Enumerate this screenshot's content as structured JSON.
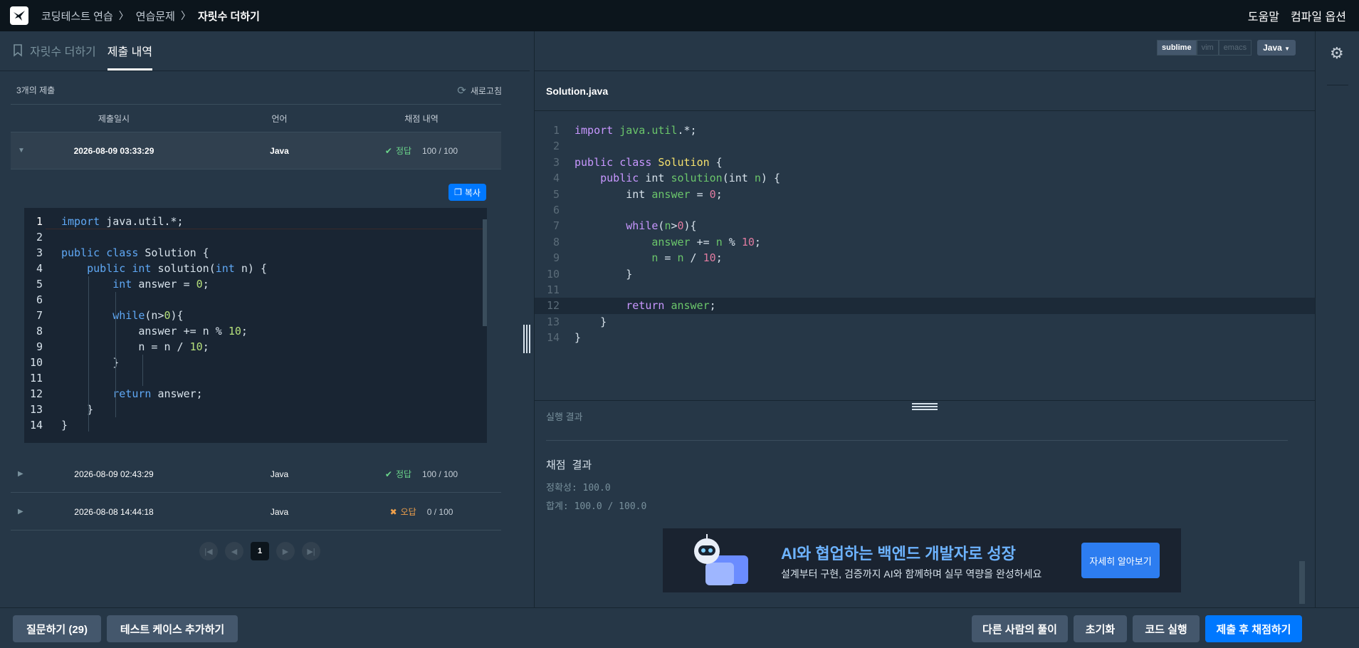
{
  "breadcrumb": {
    "items": [
      "코딩테스트 연습",
      "연습문제"
    ],
    "current": "자릿수 더하기"
  },
  "topnav": {
    "help": "도움말",
    "compile_options": "컴파일 옵션"
  },
  "tabs": [
    {
      "label": "자릿수 더하기"
    },
    {
      "label": "제출 내역"
    }
  ],
  "submissions": {
    "count_label": "3개의 제출",
    "refresh": "새로고침",
    "headers": [
      "제출일시",
      "언어",
      "채점 내역"
    ],
    "rows": [
      {
        "date": "2026-08-09 03:33:29",
        "lang": "Java",
        "result": "정답",
        "score": "100 / 100"
      },
      {
        "date": "2026-08-09 02:43:29",
        "lang": "Java",
        "result": "정답",
        "score": "100 / 100"
      },
      {
        "date": "2026-08-08 14:44:18",
        "lang": "Java",
        "result": "오답",
        "score": "0 / 100"
      }
    ],
    "copy": "복사"
  },
  "pager": {
    "page": "1"
  },
  "editor": {
    "keymaps": [
      "sublime",
      "vim",
      "emacs"
    ],
    "language": "Java",
    "filename": "Solution.java"
  },
  "run": {
    "header": "실행 결과",
    "title": "채점 결과",
    "accuracy": "정확성: 100.0",
    "total": "합계: 100.0 / 100.0"
  },
  "ad": {
    "title": "AI와 협업하는 백엔드 개발자로 성장",
    "subtitle": "설계부터 구현, 검증까지 AI와 함께하며 실무 역량을 완성하세요",
    "button": "자세히 알아보기"
  },
  "bottom": {
    "question": "질문하기 (29)",
    "add_test": "테스트 케이스 추가하기",
    "others": "다른 사람의 풀이",
    "reset": "초기화",
    "run": "코드 실행",
    "submit": "제출 후 채점하기"
  },
  "colors": {
    "accent": "#0078ff",
    "ok": "#6bd68b",
    "fail": "#f0a04b"
  }
}
